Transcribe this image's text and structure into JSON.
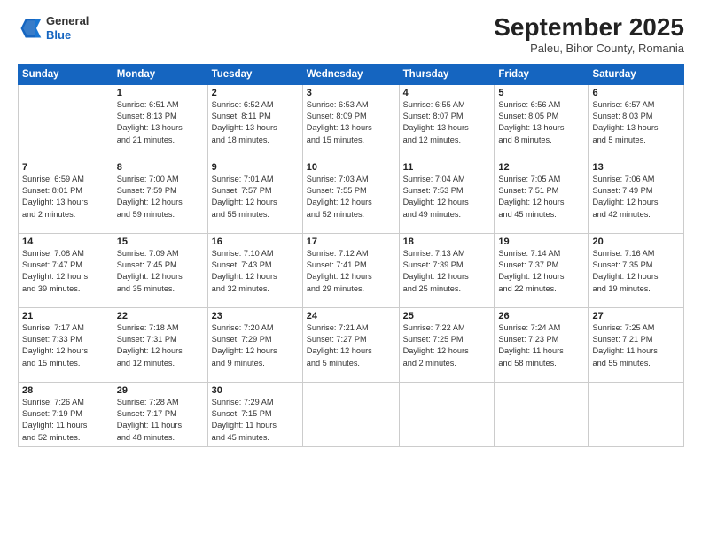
{
  "header": {
    "logo_general": "General",
    "logo_blue": "Blue",
    "month_title": "September 2025",
    "location": "Paleu, Bihor County, Romania"
  },
  "days_of_week": [
    "Sunday",
    "Monday",
    "Tuesday",
    "Wednesday",
    "Thursday",
    "Friday",
    "Saturday"
  ],
  "weeks": [
    [
      {
        "num": "",
        "info": ""
      },
      {
        "num": "1",
        "info": "Sunrise: 6:51 AM\nSunset: 8:13 PM\nDaylight: 13 hours\nand 21 minutes."
      },
      {
        "num": "2",
        "info": "Sunrise: 6:52 AM\nSunset: 8:11 PM\nDaylight: 13 hours\nand 18 minutes."
      },
      {
        "num": "3",
        "info": "Sunrise: 6:53 AM\nSunset: 8:09 PM\nDaylight: 13 hours\nand 15 minutes."
      },
      {
        "num": "4",
        "info": "Sunrise: 6:55 AM\nSunset: 8:07 PM\nDaylight: 13 hours\nand 12 minutes."
      },
      {
        "num": "5",
        "info": "Sunrise: 6:56 AM\nSunset: 8:05 PM\nDaylight: 13 hours\nand 8 minutes."
      },
      {
        "num": "6",
        "info": "Sunrise: 6:57 AM\nSunset: 8:03 PM\nDaylight: 13 hours\nand 5 minutes."
      }
    ],
    [
      {
        "num": "7",
        "info": "Sunrise: 6:59 AM\nSunset: 8:01 PM\nDaylight: 13 hours\nand 2 minutes."
      },
      {
        "num": "8",
        "info": "Sunrise: 7:00 AM\nSunset: 7:59 PM\nDaylight: 12 hours\nand 59 minutes."
      },
      {
        "num": "9",
        "info": "Sunrise: 7:01 AM\nSunset: 7:57 PM\nDaylight: 12 hours\nand 55 minutes."
      },
      {
        "num": "10",
        "info": "Sunrise: 7:03 AM\nSunset: 7:55 PM\nDaylight: 12 hours\nand 52 minutes."
      },
      {
        "num": "11",
        "info": "Sunrise: 7:04 AM\nSunset: 7:53 PM\nDaylight: 12 hours\nand 49 minutes."
      },
      {
        "num": "12",
        "info": "Sunrise: 7:05 AM\nSunset: 7:51 PM\nDaylight: 12 hours\nand 45 minutes."
      },
      {
        "num": "13",
        "info": "Sunrise: 7:06 AM\nSunset: 7:49 PM\nDaylight: 12 hours\nand 42 minutes."
      }
    ],
    [
      {
        "num": "14",
        "info": "Sunrise: 7:08 AM\nSunset: 7:47 PM\nDaylight: 12 hours\nand 39 minutes."
      },
      {
        "num": "15",
        "info": "Sunrise: 7:09 AM\nSunset: 7:45 PM\nDaylight: 12 hours\nand 35 minutes."
      },
      {
        "num": "16",
        "info": "Sunrise: 7:10 AM\nSunset: 7:43 PM\nDaylight: 12 hours\nand 32 minutes."
      },
      {
        "num": "17",
        "info": "Sunrise: 7:12 AM\nSunset: 7:41 PM\nDaylight: 12 hours\nand 29 minutes."
      },
      {
        "num": "18",
        "info": "Sunrise: 7:13 AM\nSunset: 7:39 PM\nDaylight: 12 hours\nand 25 minutes."
      },
      {
        "num": "19",
        "info": "Sunrise: 7:14 AM\nSunset: 7:37 PM\nDaylight: 12 hours\nand 22 minutes."
      },
      {
        "num": "20",
        "info": "Sunrise: 7:16 AM\nSunset: 7:35 PM\nDaylight: 12 hours\nand 19 minutes."
      }
    ],
    [
      {
        "num": "21",
        "info": "Sunrise: 7:17 AM\nSunset: 7:33 PM\nDaylight: 12 hours\nand 15 minutes."
      },
      {
        "num": "22",
        "info": "Sunrise: 7:18 AM\nSunset: 7:31 PM\nDaylight: 12 hours\nand 12 minutes."
      },
      {
        "num": "23",
        "info": "Sunrise: 7:20 AM\nSunset: 7:29 PM\nDaylight: 12 hours\nand 9 minutes."
      },
      {
        "num": "24",
        "info": "Sunrise: 7:21 AM\nSunset: 7:27 PM\nDaylight: 12 hours\nand 5 minutes."
      },
      {
        "num": "25",
        "info": "Sunrise: 7:22 AM\nSunset: 7:25 PM\nDaylight: 12 hours\nand 2 minutes."
      },
      {
        "num": "26",
        "info": "Sunrise: 7:24 AM\nSunset: 7:23 PM\nDaylight: 11 hours\nand 58 minutes."
      },
      {
        "num": "27",
        "info": "Sunrise: 7:25 AM\nSunset: 7:21 PM\nDaylight: 11 hours\nand 55 minutes."
      }
    ],
    [
      {
        "num": "28",
        "info": "Sunrise: 7:26 AM\nSunset: 7:19 PM\nDaylight: 11 hours\nand 52 minutes."
      },
      {
        "num": "29",
        "info": "Sunrise: 7:28 AM\nSunset: 7:17 PM\nDaylight: 11 hours\nand 48 minutes."
      },
      {
        "num": "30",
        "info": "Sunrise: 7:29 AM\nSunset: 7:15 PM\nDaylight: 11 hours\nand 45 minutes."
      },
      {
        "num": "",
        "info": ""
      },
      {
        "num": "",
        "info": ""
      },
      {
        "num": "",
        "info": ""
      },
      {
        "num": "",
        "info": ""
      }
    ]
  ]
}
